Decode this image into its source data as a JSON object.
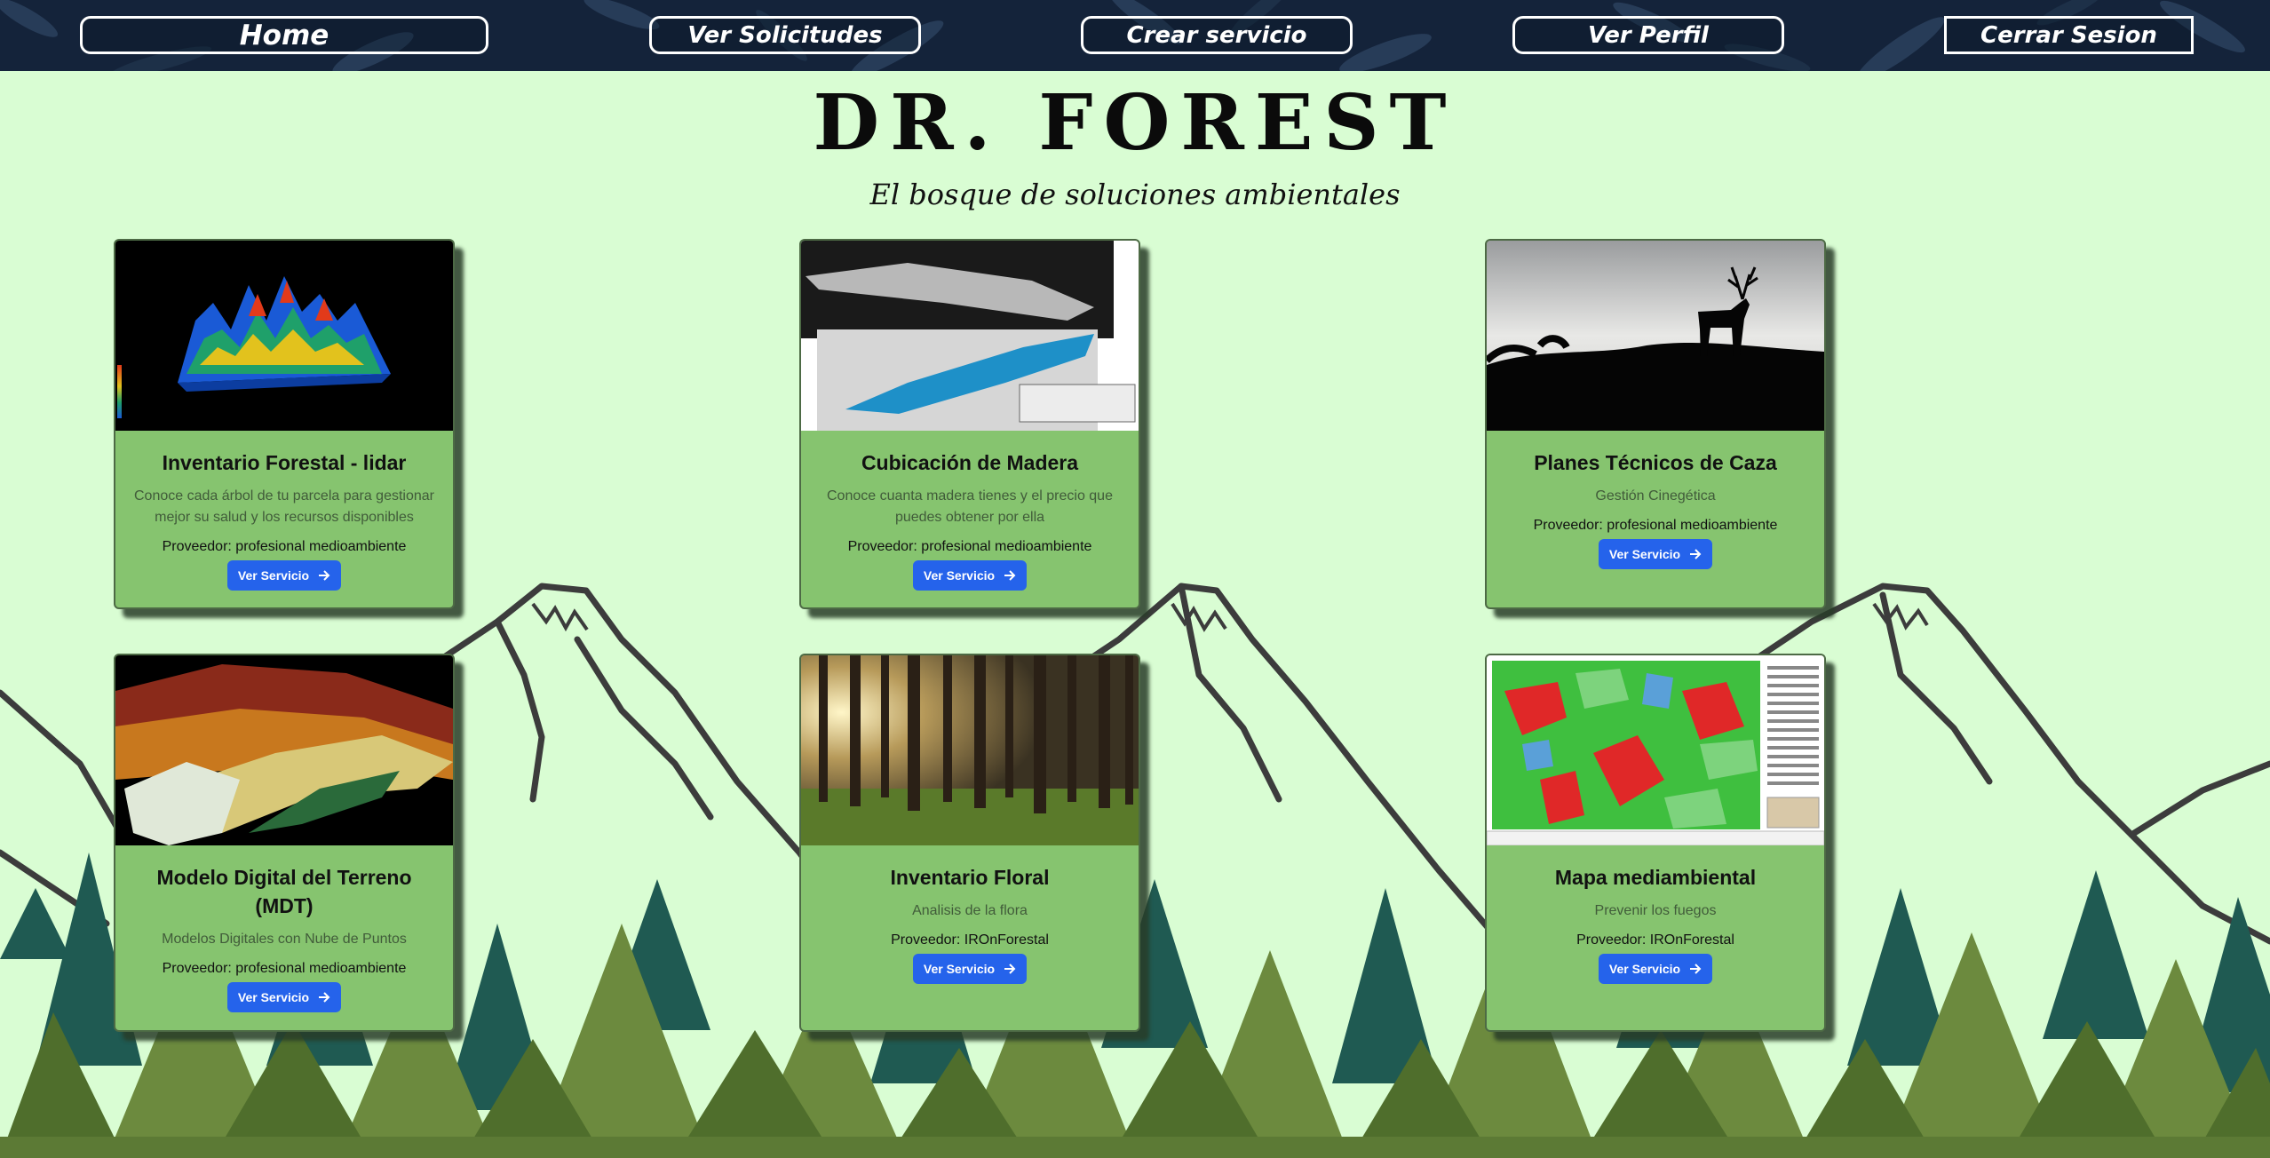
{
  "nav": {
    "home": "Home",
    "requests": "Ver Solicitudes",
    "create": "Crear servicio",
    "profile": "Ver Perfil",
    "logout": "Cerrar Sesion"
  },
  "header": {
    "brand": "DR. FOREST",
    "tagline": "El bosque de soluciones ambientales"
  },
  "cards": [
    {
      "title": "Inventario Forestal - lidar",
      "description": "Conoce cada árbol de tu parcela para gestionar mejor su salud y los recursos disponibles",
      "provider": "Proveedor: profesional medioambiente",
      "button": "Ver Servicio",
      "image_icon": "lidar-point-cloud-image"
    },
    {
      "title": "Cubicación de Madera",
      "description": "Conoce cuanta madera tienes y el precio que puedes obtener por ella",
      "provider": "Proveedor: profesional medioambiente",
      "button": "Ver Servicio",
      "image_icon": "log-scan-image"
    },
    {
      "title": "Planes Técnicos de Caza",
      "description": "Gestión Cinegética",
      "provider": "Proveedor: profesional medioambiente",
      "button": "Ver Servicio",
      "image_icon": "deer-silhouette-image"
    },
    {
      "title": "Modelo Digital del Terreno (MDT)",
      "description": "Modelos Digitales con Nube de Puntos",
      "provider": "Proveedor: profesional medioambiente",
      "button": "Ver Servicio",
      "image_icon": "terrain-model-image"
    },
    {
      "title": "Inventario Floral",
      "description": "Analisis de la flora",
      "provider": "Proveedor: IROnForestal",
      "button": "Ver Servicio",
      "image_icon": "forest-photo-image"
    },
    {
      "title": "Mapa mediambiental",
      "description": "Prevenir los fuegos",
      "provider": "Proveedor: IROnForestal",
      "button": "Ver Servicio",
      "image_icon": "land-use-map-image"
    }
  ],
  "colors": {
    "page_bg": "#d9fdd3",
    "card_bg": "#86c46f",
    "button_bg": "#2563eb",
    "nav_bg": "#14233a",
    "tree_dark": "#1f5a52",
    "tree_olive": "#5c7a35"
  }
}
